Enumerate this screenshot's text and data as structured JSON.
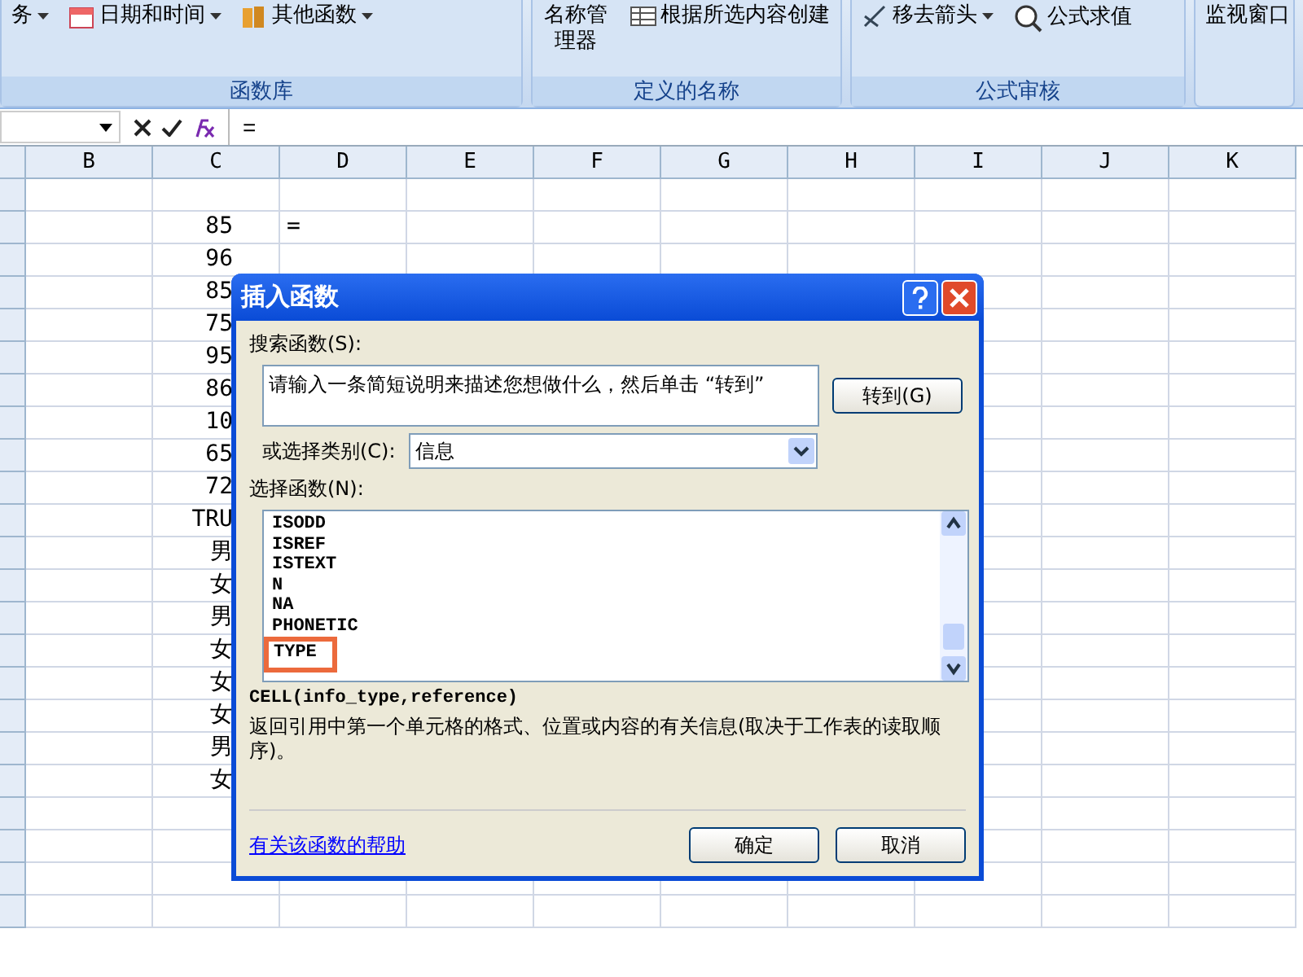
{
  "ribbon": {
    "groups": [
      {
        "label": "函数库",
        "commands": [
          {
            "label": "务",
            "dropdown": true
          },
          {
            "label": "日期和时间",
            "dropdown": true
          },
          {
            "label": "其他函数",
            "dropdown": true
          }
        ]
      },
      {
        "label": "定义的名称",
        "commands": [
          {
            "label": "名称管理器",
            "dropdown": false
          },
          {
            "label": "根据所选内容创建",
            "dropdown": false
          }
        ]
      },
      {
        "label": "公式审核",
        "commands": [
          {
            "label": "移去箭头",
            "dropdown": true
          },
          {
            "label": "公式求值",
            "dropdown": false
          }
        ]
      },
      {
        "commands": [
          {
            "label": "监视窗口",
            "dropdown": false
          }
        ]
      }
    ]
  },
  "formula_bar": {
    "value": "="
  },
  "sheet": {
    "columns": [
      "B",
      "C",
      "D",
      "E",
      "F",
      "G",
      "H",
      "I",
      "J",
      "K"
    ],
    "rows": [
      [
        "",
        "",
        ""
      ],
      [
        "",
        "85",
        "="
      ],
      [
        "",
        "96",
        ""
      ],
      [
        "",
        "85",
        ""
      ],
      [
        "",
        "75",
        ""
      ],
      [
        "",
        "95",
        ""
      ],
      [
        "",
        "86",
        ""
      ],
      [
        "",
        "10",
        ""
      ],
      [
        "",
        "65",
        ""
      ],
      [
        "",
        "72",
        ""
      ],
      [
        "",
        "TRU",
        ""
      ],
      [
        "",
        "男",
        ""
      ],
      [
        "",
        "女",
        ""
      ],
      [
        "",
        "男",
        ""
      ],
      [
        "",
        "女",
        ""
      ],
      [
        "",
        "女",
        ""
      ],
      [
        "",
        "女",
        ""
      ],
      [
        "",
        "男",
        ""
      ],
      [
        "",
        "女",
        ""
      ],
      [
        "",
        "",
        ""
      ],
      [
        "",
        "",
        ""
      ],
      [
        "",
        "",
        ""
      ],
      [
        "",
        "",
        ""
      ]
    ]
  },
  "dialog": {
    "title": "插入函数",
    "search_label": "搜索函数(S):",
    "search_value": "请输入一条简短说明来描述您想做什么，然后单击 “转到”",
    "go_button": "转到(G)",
    "category_label": "或选择类别(C):",
    "category_value": "信息",
    "list_label": "选择函数(N):",
    "functions": [
      {
        "name": "ISODD",
        "selected": false
      },
      {
        "name": "ISREF",
        "selected": false
      },
      {
        "name": "ISTEXT",
        "selected": false
      },
      {
        "name": "N",
        "selected": false
      },
      {
        "name": "NA",
        "selected": false
      },
      {
        "name": "PHONETIC",
        "selected": false
      },
      {
        "name": "TYPE",
        "selected": true
      }
    ],
    "signature": "CELL(info_type,reference)",
    "description": "返回引用中第一个单元格的格式、位置或内容的有关信息(取决于工作表的读取顺序)。",
    "help_link": "有关该函数的帮助",
    "ok_button": "确定",
    "cancel_button": "取消"
  }
}
